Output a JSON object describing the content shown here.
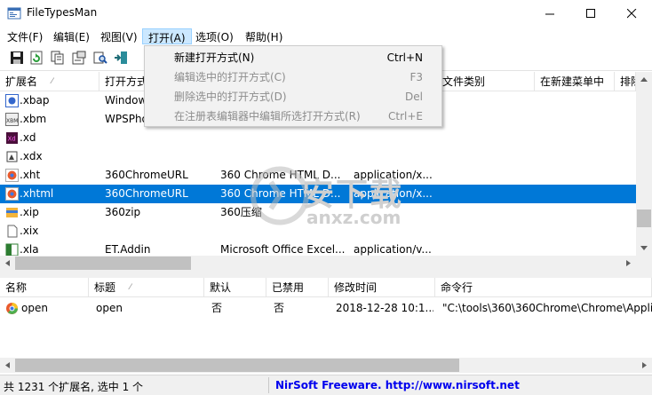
{
  "window": {
    "title": "FileTypesMan"
  },
  "menubar": [
    {
      "label": "文件(F)"
    },
    {
      "label": "编辑(E)"
    },
    {
      "label": "视图(V)"
    },
    {
      "label": "打开(A)"
    },
    {
      "label": "选项(O)"
    },
    {
      "label": "帮助(H)"
    }
  ],
  "toolbar": [
    {
      "icon": "save-icon"
    },
    {
      "icon": "refresh-icon"
    },
    {
      "icon": "copy-icon"
    },
    {
      "icon": "properties-icon"
    },
    {
      "icon": "find-icon"
    },
    {
      "icon": "exit-icon"
    }
  ],
  "list": {
    "headers": [
      "扩展名",
      "打开方式",
      "",
      "",
      "文件类别",
      "在新建菜单中",
      "排除"
    ],
    "rows": [
      {
        "ext": ".xbap",
        "open": "Window",
        "type": "",
        "mime": "",
        "icon_color": "#3366cc",
        "selected": false
      },
      {
        "ext": ".xbm",
        "open": "WPSPho",
        "type": "",
        "mime": "",
        "icon_color": "#6f6f6f",
        "selected": false
      },
      {
        "ext": ".xd",
        "open": "",
        "type": "",
        "mime": "",
        "icon_color": "#4a0f3a",
        "selected": false
      },
      {
        "ext": ".xdx",
        "open": "",
        "type": "",
        "mime": "",
        "icon_color": "#444444",
        "selected": false
      },
      {
        "ext": ".xht",
        "open": "360ChromeURL",
        "type": "360 Chrome HTML D...",
        "mime": "application/x...",
        "icon_color": "#e95a2c",
        "selected": false
      },
      {
        "ext": ".xhtml",
        "open": "360ChromeURL",
        "type": "360 Chrome HTML D...",
        "mime": "application/x...",
        "icon_color": "#e95a2c",
        "selected": true
      },
      {
        "ext": ".xip",
        "open": "360zip",
        "type": "360压缩",
        "mime": "",
        "icon_color": "#f3b43a",
        "selected": false
      },
      {
        "ext": ".xix",
        "open": "",
        "type": "",
        "mime": "",
        "icon_color": "#ffffff",
        "selected": false
      },
      {
        "ext": ".xla",
        "open": "ET.Addin",
        "type": "Microsoft Office Excel...",
        "mime": "application/v...",
        "icon_color": "#2e7d32",
        "selected": false
      }
    ]
  },
  "open_menu": [
    {
      "label": "新建打开方式(N)",
      "shortcut": "Ctrl+N",
      "enabled": true
    },
    {
      "label": "编辑选中的打开方式(C)",
      "shortcut": "F3",
      "enabled": false
    },
    {
      "label": "删除选中的打开方式(D)",
      "shortcut": "Del",
      "enabled": false
    },
    {
      "label": "在注册表编辑器中编辑所选打开方式(R)",
      "shortcut": "Ctrl+E",
      "enabled": false
    }
  ],
  "lower": {
    "headers": [
      "名称",
      "标题",
      "默认",
      "已禁用",
      "修改时间",
      "命令行"
    ],
    "rows": [
      {
        "name": "open",
        "title": "open",
        "default": "否",
        "disabled": "否",
        "modified": "2018-12-28 10:1...",
        "cmd": "\"C:\\tools\\360\\360Chrome\\Chrome\\Appli"
      }
    ]
  },
  "status": {
    "left": "共 1231 个扩展名, 选中 1 个",
    "link": "NirSoft Freeware.  http://www.nirsoft.net"
  },
  "watermark": {
    "cn": "安下载",
    "en": "anxz.com"
  }
}
